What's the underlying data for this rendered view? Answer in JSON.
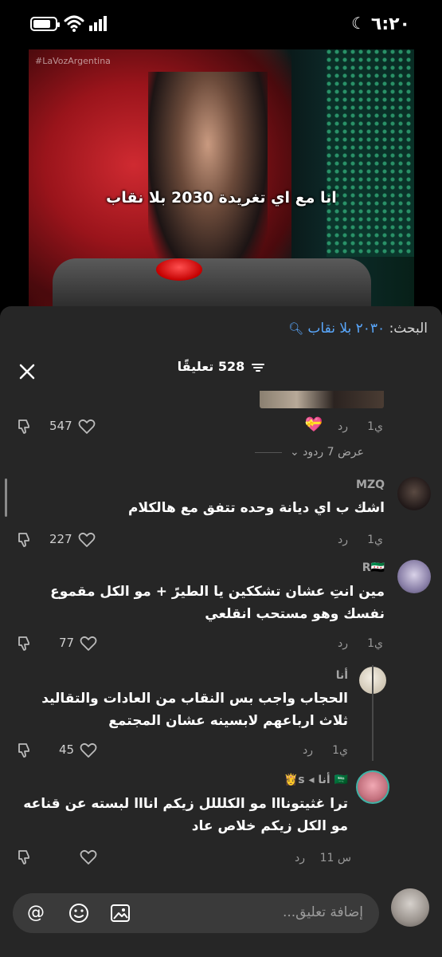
{
  "status_bar": {
    "time": "٦:٢٠",
    "moon": "☾"
  },
  "video": {
    "watermark": "#LaVozArgentina",
    "caption": "انا مع اي تغريدة 2030 بلا نقاب"
  },
  "search": {
    "label": "البحث:",
    "term": "٢٠٣٠ بلا نقاب"
  },
  "comments_header": {
    "count_label": "528 تعليقًا"
  },
  "top_reply": {
    "time": "1ي",
    "reply": "رد",
    "likes": "547"
  },
  "view_replies": "عرض 7 ردود",
  "comments": [
    {
      "user": "MZQ",
      "text": "اشك ب اي ديانة وحده تتفق مع هالكلام",
      "time": "1ي",
      "reply": "رد",
      "likes": "227"
    },
    {
      "user": "R🇸🇾",
      "text": "مين انتِ عشان تشككين يا الطيرً + مو الكل مقموع نفسك وهو مستحب انقلعي",
      "time": "1ي",
      "reply": "رد",
      "likes": "77"
    },
    {
      "user": "أنا",
      "text": "الحجاب واجب بس النقاب من العادات والتقاليد ثلاث ارباعهم لابسينه عشان المجتمع",
      "time": "1ي",
      "reply": "رد",
      "likes": "45"
    },
    {
      "user": "🇸🇦 أنا ◂ s👸",
      "text": "ترا غثيتونااا مو الكلللل زيكم انااا لبسته عن قناعه مو الكل زيكم خلاص عاد",
      "time": "11 س",
      "reply": "رد",
      "likes": ""
    }
  ],
  "input": {
    "placeholder": "إضافة تعليق..."
  }
}
